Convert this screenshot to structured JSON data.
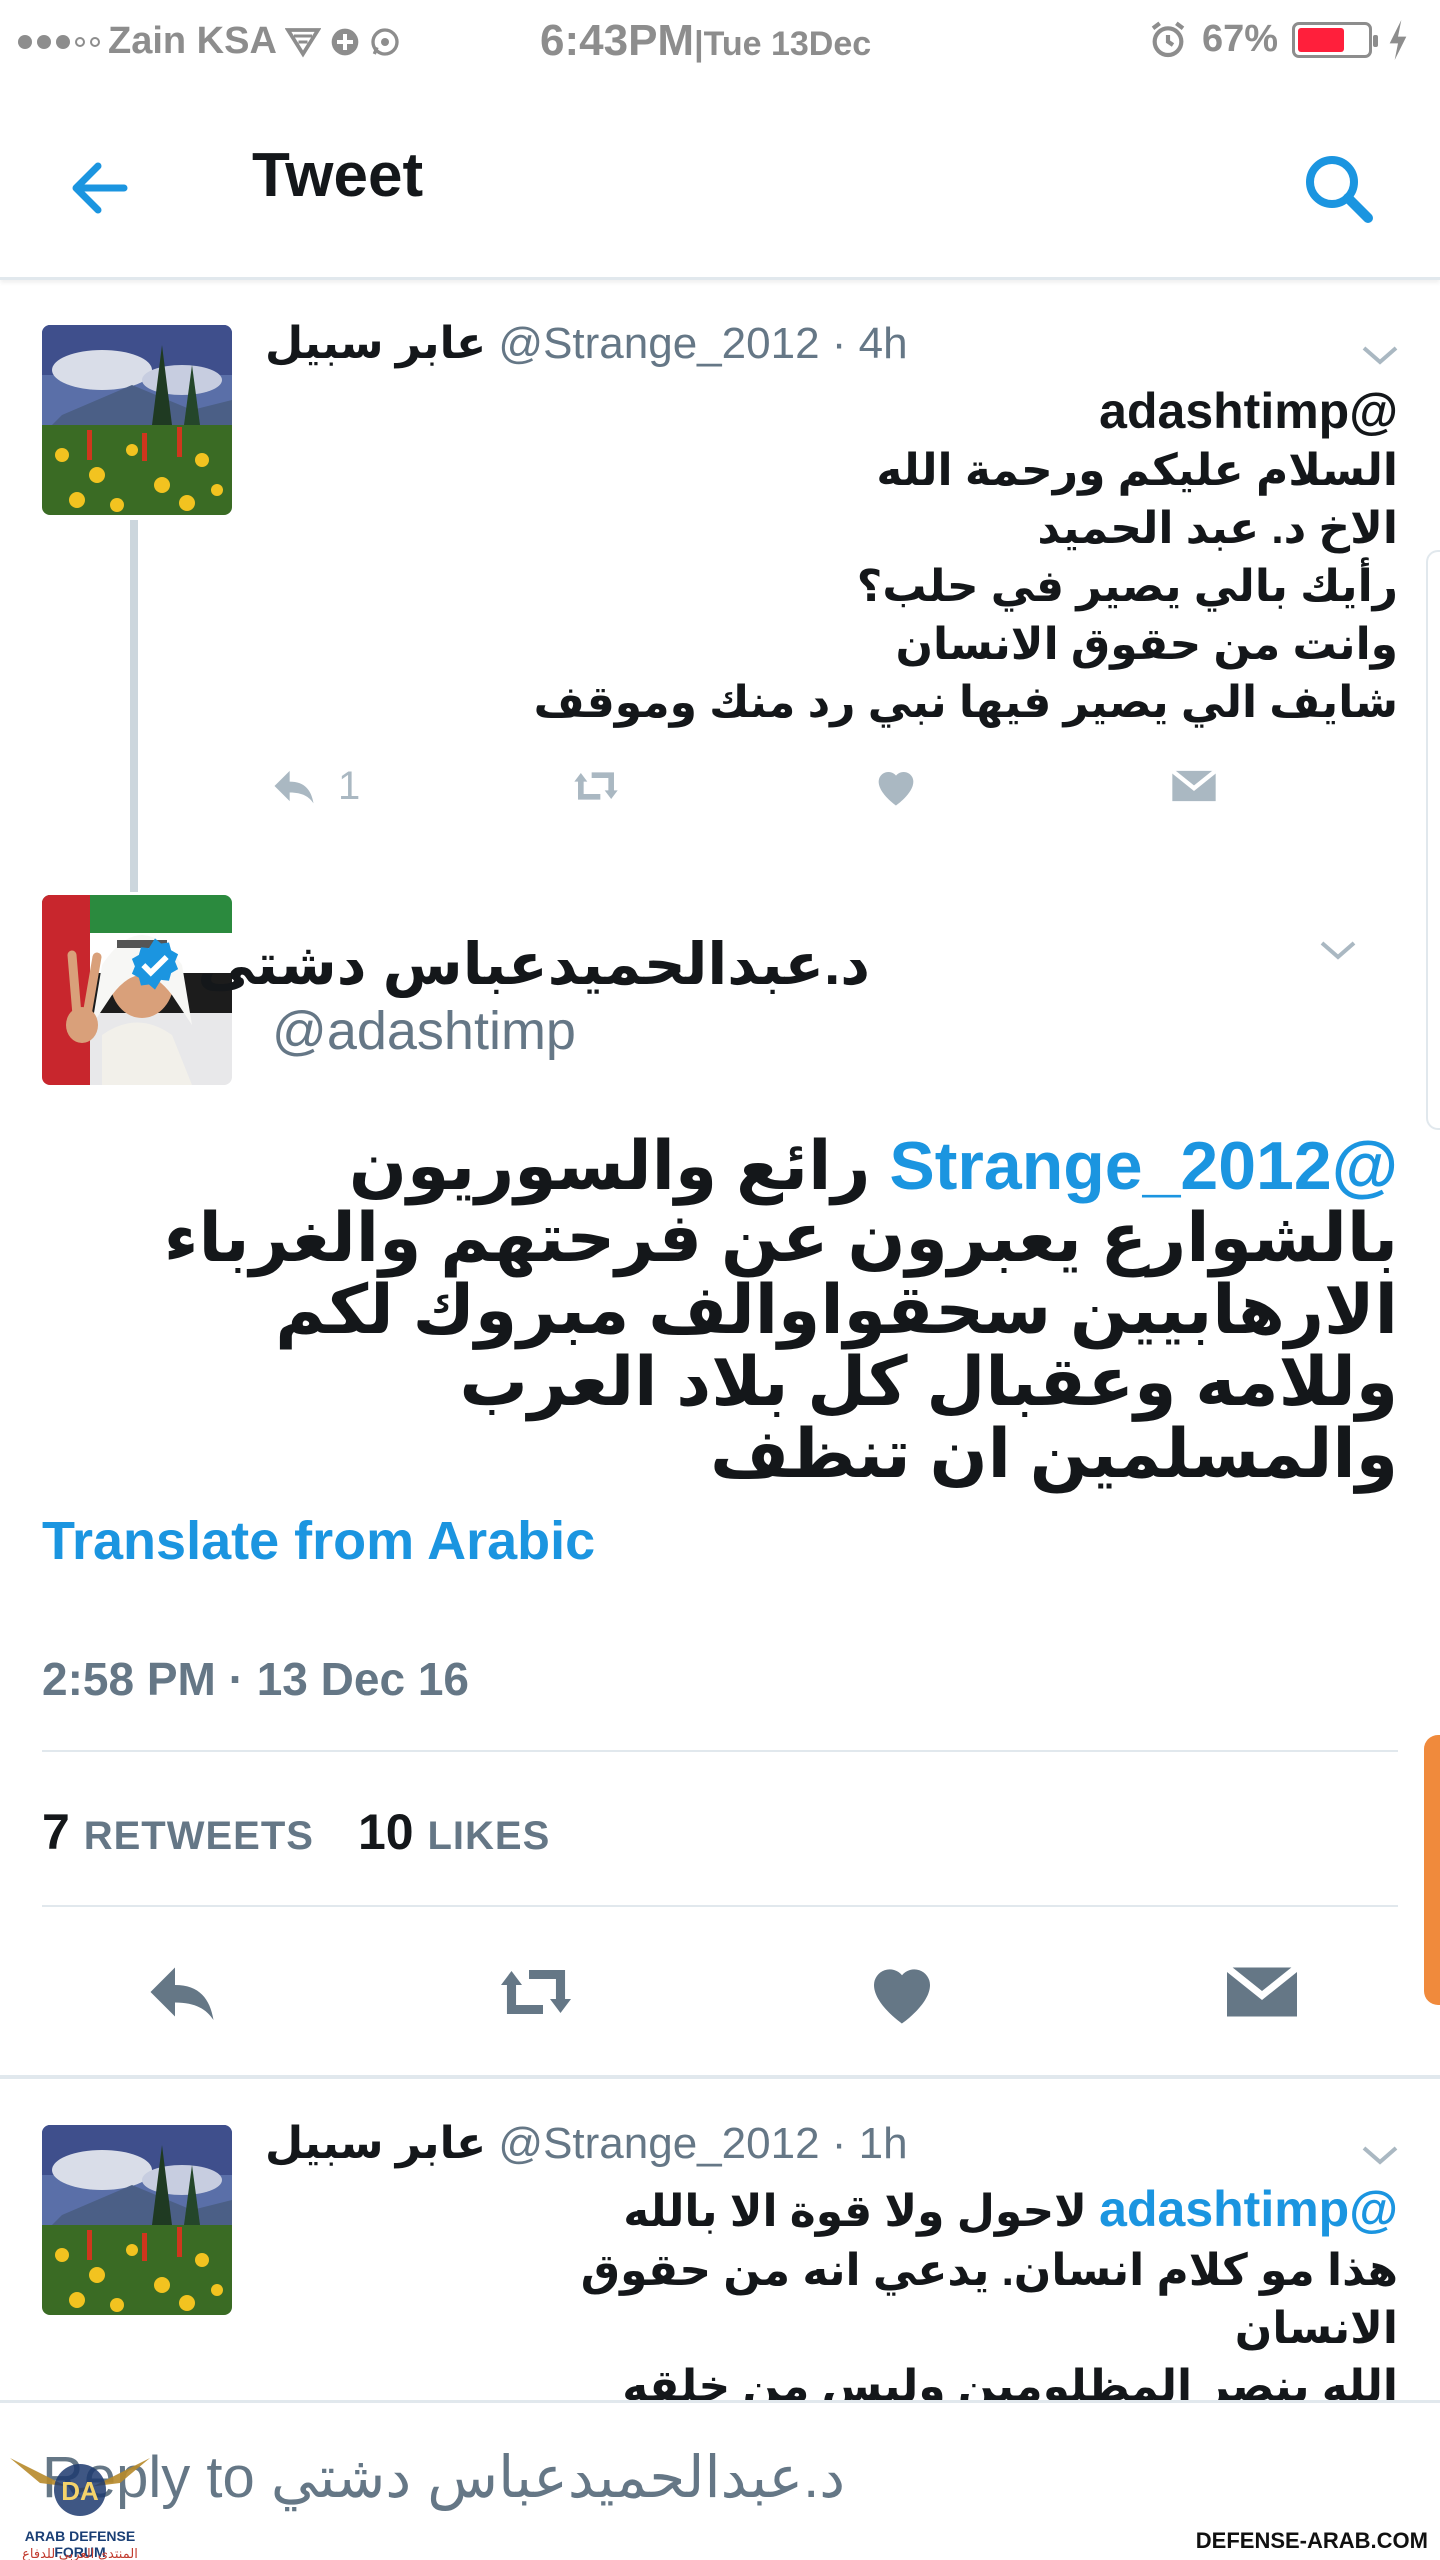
{
  "status_bar": {
    "carrier": "Zain KSA",
    "time": "6:43PM",
    "date": "|Tue 13Dec",
    "battery": "67%",
    "battery_level": 0.67,
    "icons": [
      "signal-dots-icon",
      "wifi-icon",
      "location-icon",
      "whatsapp-icon",
      "alarm-icon",
      "battery-icon",
      "charging-icon"
    ]
  },
  "nav": {
    "title": "Tweet",
    "icons": [
      "back-arrow-icon",
      "search-icon"
    ]
  },
  "tweet1": {
    "display_name": "عابر سبيل",
    "handle": "@Strange_2012",
    "time": " · 4h",
    "mention": "@adashtimp",
    "text": "السلام عليكم ورحمة الله\nالاخ د. عبد الحميد\nرأيك بالي يصير في حلب؟\nوانت من حقوق الانسان\nشايف الي يصير فيها نبي  رد منك وموقف",
    "reply_count": "1"
  },
  "main_tweet": {
    "display_name": "د.عبدالحميدعباس دشتى",
    "handle": "@adashtimp",
    "mention": "@Strange_2012",
    "text": " رائع والسوريون بالشوارع يعبرون عن فرحتهم والغرباء الارهابيين سحقواوالف مبروك لكم وللامه وعقبال كل بلاد العرب والمسلمين ان تنظف",
    "translate": "Translate from Arabic",
    "timestamp": "2:58 PM · 13 Dec 16",
    "retweets_count": "7",
    "retweets_label": "RETWEETS",
    "likes_count": "10",
    "likes_label": "LIKES"
  },
  "tweet3": {
    "display_name": "عابر سبيل",
    "handle": "@Strange_2012",
    "time": " · 1h",
    "mention": "@adashtimp",
    "line1": " لاحول ولا قوة الا بالله",
    "text": "هذا مو كلام انسان. يدعي انه من حقوق الانسان\nالله ينصر المظلومين وليس من خلقه"
  },
  "reply_bar": {
    "prefix": "Reply to",
    "name": "د.عبدالحميدعباس دشتي"
  },
  "watermark": {
    "logo_text": "DA",
    "forum_en": "ARAB DEFENSE FORUM",
    "forum_ar": "المنتدى العربي للدفاع والتسليح",
    "site": "DEFENSE-ARAB.COM"
  },
  "colors": {
    "accent": "#1b95e0",
    "secondary_text": "#657786",
    "action_gray": "#aab8c2",
    "battery_red": "#ff1f3b"
  }
}
